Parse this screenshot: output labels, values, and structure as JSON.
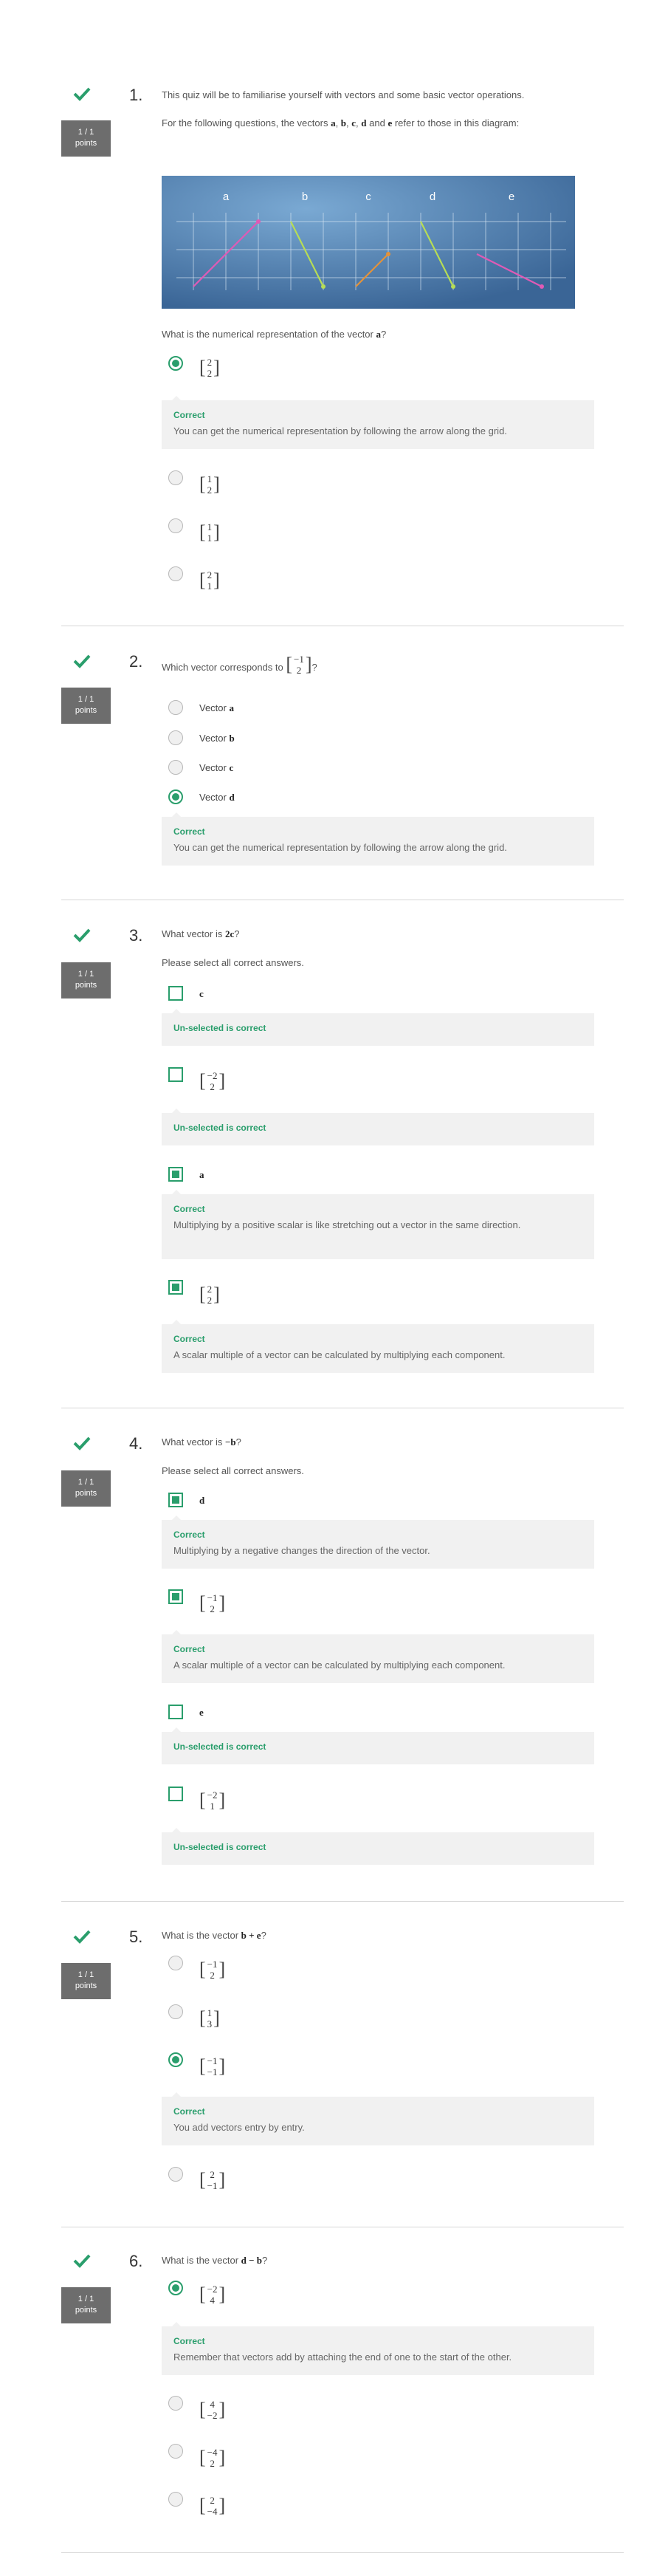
{
  "score": {
    "points_value": "1 / 1",
    "points_label": "points"
  },
  "colors": {
    "correct": "#2a9e6c",
    "badge_bg": "#6d6d6d",
    "feedback_bg": "#f1f1f1"
  },
  "icons": {
    "status": "checkmark-icon"
  },
  "q1": {
    "num": "1.",
    "intro": "This quiz will be to familiarise yourself with vectors and some basic vector operations.",
    "lead_pre": "For the following questions, the vectors ",
    "lead_vars": [
      "a",
      "b",
      "c",
      "d",
      "e"
    ],
    "lead_post": " refer to those in this diagram:",
    "diagram_labels": [
      "a",
      "b",
      "c",
      "d",
      "e"
    ],
    "question_pre": "What is the numerical representation of the vector ",
    "question_var": "a",
    "question_post": "?",
    "options": [
      {
        "top": "2",
        "bottom": "2",
        "selected": true
      },
      {
        "top": "1",
        "bottom": "2",
        "selected": false
      },
      {
        "top": "1",
        "bottom": "1",
        "selected": false
      },
      {
        "top": "2",
        "bottom": "1",
        "selected": false
      }
    ],
    "feedback": {
      "title": "Correct",
      "text": "You can get the numerical representation by following the arrow along the grid."
    }
  },
  "q2": {
    "num": "2.",
    "question_pre": "Which vector corresponds to ",
    "question_vec": {
      "top": "−1",
      "bottom": "2"
    },
    "question_post": "?",
    "option_prefix": "Vector ",
    "options": [
      {
        "var": "a",
        "selected": false
      },
      {
        "var": "b",
        "selected": false
      },
      {
        "var": "c",
        "selected": false
      },
      {
        "var": "d",
        "selected": true
      }
    ],
    "feedback": {
      "title": "Correct",
      "text": "You can get the numerical representation by following the arrow along the grid."
    }
  },
  "q3": {
    "num": "3.",
    "question_pre": "What vector is ",
    "question_expr": "2c",
    "question_post": "?",
    "instruction": "Please select all correct answers.",
    "options": [
      {
        "label": "c",
        "selected": false,
        "feedback_title": "Un-selected is correct",
        "feedback_text": ""
      },
      {
        "top": "−2",
        "bottom": "2",
        "selected": false,
        "feedback_title": "Un-selected is correct",
        "feedback_text": ""
      },
      {
        "label": "a",
        "selected": true,
        "feedback_title": "Correct",
        "feedback_text": "Multiplying by a positive scalar is like stretching out a vector in the same direction."
      },
      {
        "top": "2",
        "bottom": "2",
        "selected": true,
        "feedback_title": "Correct",
        "feedback_text": "A scalar multiple of a vector can be calculated by multiplying each component."
      }
    ]
  },
  "q4": {
    "num": "4.",
    "question_pre": "What vector is ",
    "question_expr": "−b",
    "question_post": "?",
    "instruction": "Please select all correct answers.",
    "options": [
      {
        "label": "d",
        "selected": true,
        "feedback_title": "Correct",
        "feedback_text": "Multiplying by a negative changes the direction of the vector."
      },
      {
        "top": "−1",
        "bottom": "2",
        "selected": true,
        "feedback_title": "Correct",
        "feedback_text": "A scalar multiple of a vector can be calculated by multiplying each component."
      },
      {
        "label": "e",
        "selected": false,
        "feedback_title": "Un-selected is correct",
        "feedback_text": ""
      },
      {
        "top": "−2",
        "bottom": "1",
        "selected": false,
        "feedback_title": "Un-selected is correct",
        "feedback_text": ""
      }
    ]
  },
  "q5": {
    "num": "5.",
    "question_pre": "What is the vector ",
    "question_expr": "b + e",
    "question_post": "?",
    "options": [
      {
        "top": "−1",
        "bottom": "2",
        "selected": false
      },
      {
        "top": "1",
        "bottom": "3",
        "selected": false
      },
      {
        "top": "−1",
        "bottom": "−1",
        "selected": true
      },
      {
        "top": "2",
        "bottom": "−1",
        "selected": false
      }
    ],
    "feedback": {
      "title": "Correct",
      "text": "You add vectors entry by entry."
    }
  },
  "q6": {
    "num": "6.",
    "question_pre": "What is the vector ",
    "question_expr": "d − b",
    "question_post": "?",
    "options": [
      {
        "top": "−2",
        "bottom": "4",
        "selected": true
      },
      {
        "top": "4",
        "bottom": "−2",
        "selected": false
      },
      {
        "top": "−4",
        "bottom": "2",
        "selected": false
      },
      {
        "top": "2",
        "bottom": "−4",
        "selected": false
      }
    ],
    "feedback": {
      "title": "Correct",
      "text": "Remember that vectors add by attaching the end of one to the start of the other."
    }
  }
}
